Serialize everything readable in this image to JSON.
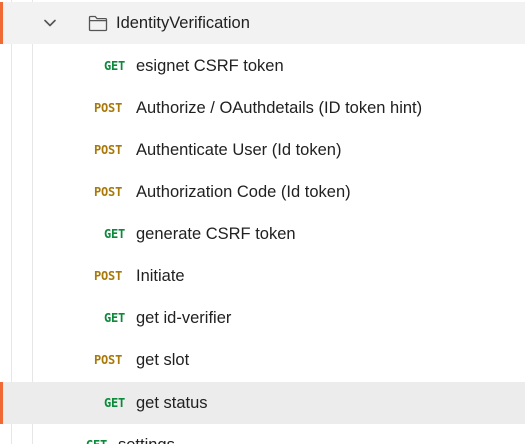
{
  "folder": {
    "name": "IdentityVerification",
    "expanded": true,
    "icon": "folder-icon",
    "chevron_icon": "chevron-down-icon"
  },
  "requests": [
    {
      "method": "GET",
      "name": "esignet CSRF token"
    },
    {
      "method": "POST",
      "name": "Authorize / OAuthdetails (ID token hint)"
    },
    {
      "method": "POST",
      "name": "Authenticate User (Id token)"
    },
    {
      "method": "POST",
      "name": "Authorization Code (Id token)"
    },
    {
      "method": "GET",
      "name": "generate CSRF token"
    },
    {
      "method": "POST",
      "name": "Initiate"
    },
    {
      "method": "GET",
      "name": "get id-verifier"
    },
    {
      "method": "POST",
      "name": "get slot"
    },
    {
      "method": "GET",
      "name": "get status",
      "selected": true
    }
  ],
  "next_request": {
    "method": "GET",
    "name": "settings"
  },
  "colors": {
    "get": "#0b8a3a",
    "post": "#a8790a",
    "accent": "#f06a35",
    "selected_bg": "#ececec",
    "folder_bg": "#f2f2f2"
  }
}
